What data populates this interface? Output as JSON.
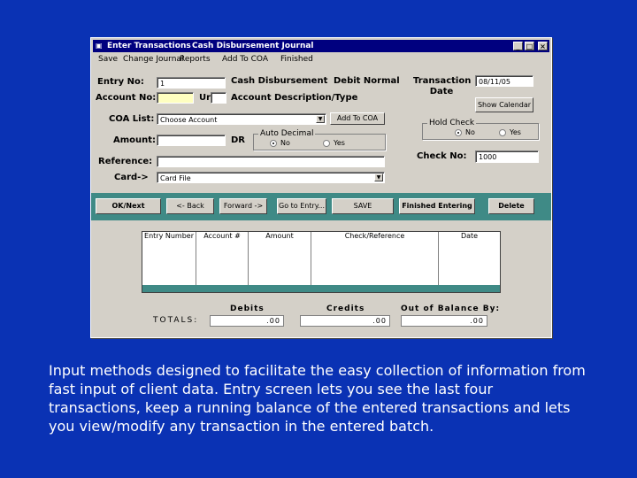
{
  "window": {
    "title": "Enter Transactions",
    "subtitle": "Cash Disbursement Journal",
    "min": "_",
    "max": "□",
    "close": "×"
  },
  "menu": [
    "Save",
    "Change Journal",
    "Reports",
    "Add To COA",
    "Finished"
  ],
  "form": {
    "entry_no_label": "Entry No:",
    "entry_no_value": "1",
    "journal_label": "Cash Disbursement",
    "debit_normal_label": "Debit Normal",
    "transaction_date_label": "Transaction Date",
    "transaction_date_value": "08/11/05",
    "account_no_label": "Account No:",
    "ur_label": "Ur",
    "account_desc_label": "Account Description/Type",
    "show_calendar": "Show Calendar",
    "coa_list_label": "COA List:",
    "coa_list_value": "Choose Account",
    "add_to_coa": "Add To COA",
    "amount_label": "Amount:",
    "dr_label": "DR",
    "auto_decimal_label": "Auto Decimal",
    "auto_no": "No",
    "auto_yes": "Yes",
    "hold_check_label": "Hold Check",
    "hold_no": "No",
    "hold_yes": "Yes",
    "check_no_label": "Check No:",
    "check_no_value": "1000",
    "reference_label": "Reference:",
    "card_label": "Card->",
    "card_value": "Card File"
  },
  "buttons": [
    "OK/Next",
    "<- Back",
    "Forward ->",
    "Go to Entry...",
    "SAVE",
    "Finished Entering",
    "Delete"
  ],
  "grid": {
    "headers": [
      "Entry Number",
      "Account #",
      "Amount",
      "Check/Reference",
      "Date"
    ]
  },
  "totals": {
    "label": "TOTALS:",
    "debits_label": "Debits",
    "credits_label": "Credits",
    "out_of_balance_label": "Out of Balance By:",
    "debits_value": ".00",
    "credits_value": ".00",
    "out_of_balance_value": ".00"
  },
  "caption": "Input methods designed to facilitate the easy collection of information from fast input of client data. Entry screen lets you see the last four transactions, keep a running balance of the entered transactions and lets you view/modify any transaction in the entered batch."
}
